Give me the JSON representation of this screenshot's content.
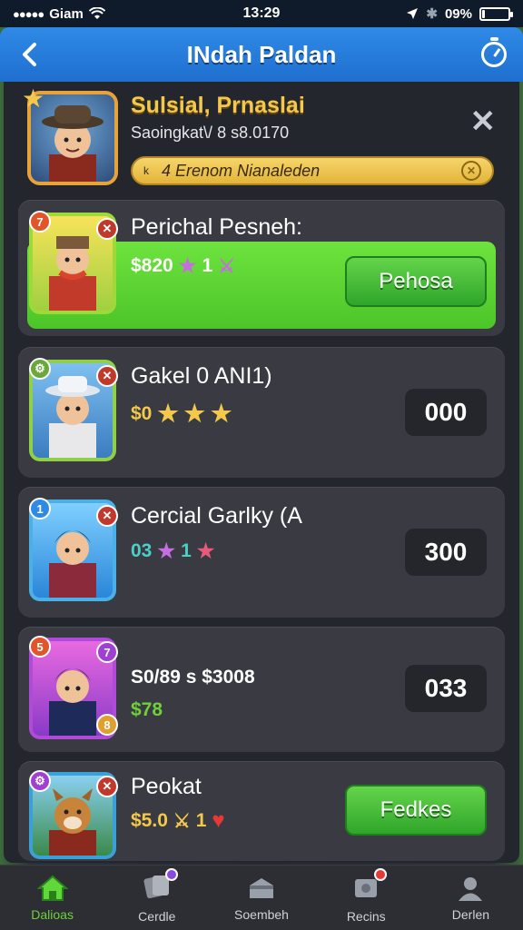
{
  "status_bar": {
    "carrier": "Giam",
    "time": "13:29",
    "battery": "09%",
    "battery_level": 0.09
  },
  "header": {
    "title": "INdah Paldan"
  },
  "profile": {
    "name": "Sulsial, Prnaslai",
    "subtitle": "Saoingkat\\/ 8 s8.0170",
    "quest_prefix": "k",
    "quest_text": "4 Erenom Nianaleden"
  },
  "cards": [
    {
      "name": "Perichal Pesneh:",
      "price": "$820",
      "extra": "1",
      "button": "Pehosa",
      "badge_tl": "7",
      "highlighted": true
    },
    {
      "name": "Gakel 0 ANI1)",
      "price": "$0",
      "count": "000",
      "badge_tl": ""
    },
    {
      "name": "Cercial Garlky (A",
      "price": "03",
      "extra": "1",
      "count": "300",
      "badge_tl": "1"
    },
    {
      "line1": "S0/89 s $3008",
      "line2": "$78",
      "count": "033",
      "badge_tl": "5",
      "badge_tr": "7",
      "badge_br": "8"
    },
    {
      "name": "Peokat",
      "price": "$5.0",
      "extra": "1",
      "button": "Fedkes"
    }
  ],
  "tabs": [
    {
      "label": "Dalioas",
      "icon": "home-icon",
      "active": true
    },
    {
      "label": "Cerdle",
      "icon": "cards-icon",
      "active": false
    },
    {
      "label": "Soembeh",
      "icon": "chest-icon",
      "active": false
    },
    {
      "label": "Recins",
      "icon": "gift-icon",
      "active": false
    },
    {
      "label": "Derlen",
      "icon": "profile-icon",
      "active": false
    }
  ],
  "colors": {
    "accent": "#2f8ae6",
    "highlight_green": "#5fd93a",
    "gold": "#f4c84a"
  }
}
